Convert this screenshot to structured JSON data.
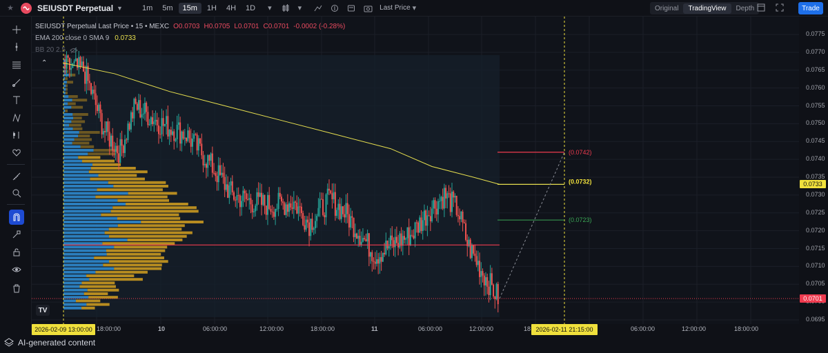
{
  "topbar": {
    "symbol": "SEIUSDT Perpetual",
    "timeframes": [
      "1m",
      "5m",
      "15m",
      "1H",
      "4H",
      "1D"
    ],
    "active_timeframe": "15m",
    "price_type": "Last Price",
    "views": [
      "Original",
      "TradingView",
      "Depth"
    ],
    "active_view": "TradingView",
    "trade_label": "Trade"
  },
  "legend": {
    "title": "SEIUSDT Perpetual Last Price • 15 • MEXC",
    "open": "O0.0703",
    "high": "H0.0705",
    "low": "L0.0701",
    "close": "C0.0701",
    "change": "-0.0002 (-0.28%)",
    "ema_label": "EMA 200 close 0 SMA 9",
    "ema_value": "0.0733",
    "bb_label": "BB 20 2.5"
  },
  "price_axis": {
    "labels": [
      "0.0775",
      "0.0770",
      "0.0765",
      "0.0760",
      "0.0755",
      "0.0750",
      "0.0745",
      "0.0740",
      "0.0735",
      "0.0730",
      "0.0725",
      "0.0720",
      "0.0715",
      "0.0710",
      "0.0705",
      "0.0700",
      "0.0695"
    ],
    "ema_tag": "0.0733",
    "last_tag": "0.0701"
  },
  "annotations": {
    "target_high": "(0.0742)",
    "target_mid": "(0.0732)",
    "target_low": "(0.0723)"
  },
  "time_axis": {
    "start_tag": "2026-02-09   13:00:00",
    "end_tag": "2026-02-11   21:15:00",
    "labels": [
      "18:00:00",
      "10",
      "06:00:00",
      "12:00:00",
      "18:00:00",
      "11",
      "06:00:00",
      "12:00:00",
      "18",
      "06:00:00",
      "12:00:00",
      "18:00:00"
    ]
  },
  "bottom": {
    "ai_label": "AI-generated content"
  },
  "colors": {
    "bull": "#26a69a",
    "bear": "#ef5350",
    "ema": "#e8e04f",
    "vp_up": "#2f8fd8",
    "vp_down": "#d4a020",
    "accent": "#1e6fe8"
  }
}
